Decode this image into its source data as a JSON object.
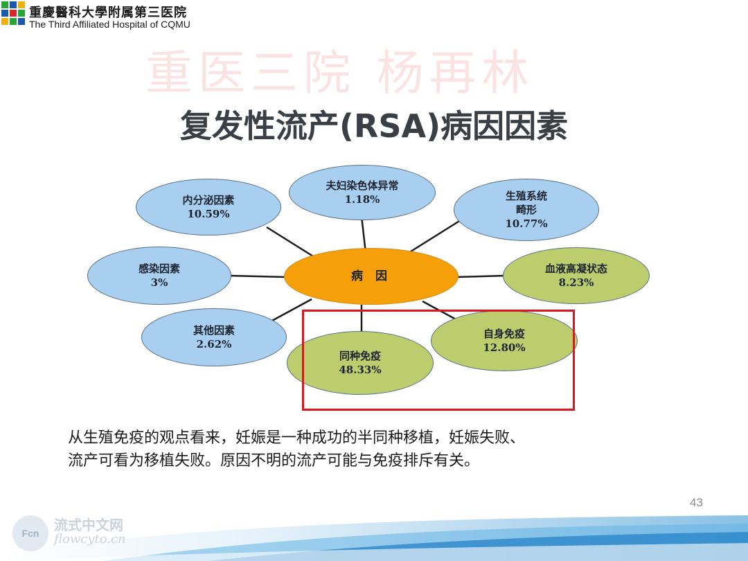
{
  "header": {
    "hospital_cn": "重慶醫科大學附属第三医院",
    "hospital_en": "The Third Affiliated Hospital of CQMU",
    "watermark": "重医三院 杨再林"
  },
  "slide": {
    "title": "复发性流产(RSA)病因因素",
    "page_number": "43"
  },
  "diagram": {
    "center": {
      "label": "病 因"
    },
    "nodes": [
      {
        "id": "chromosome",
        "label": "夫妇染色体异常",
        "value": "1.18%",
        "color": "blue"
      },
      {
        "id": "endocrine",
        "label": "内分泌因素",
        "value": "10.59%",
        "color": "blue"
      },
      {
        "id": "malformation",
        "label": "生殖系统",
        "label2": "畸形",
        "value": "10.77%",
        "color": "blue"
      },
      {
        "id": "infection",
        "label": "感染因素",
        "value": "3%",
        "color": "blue"
      },
      {
        "id": "coagulation",
        "label": "血液高凝状态",
        "value": "8.23%",
        "color": "green"
      },
      {
        "id": "other",
        "label": "其他因素",
        "value": "2.62%",
        "color": "blue"
      },
      {
        "id": "alloimmune",
        "label": "同种免疫",
        "value": "48.33%",
        "color": "green"
      },
      {
        "id": "autoimmune",
        "label": "自身免疫",
        "value": "12.80%",
        "color": "green"
      }
    ],
    "colors": {
      "blue": "#a9cff0",
      "green": "#bdcd6d",
      "center": "#f5a00a",
      "highlight": "#e0141c"
    }
  },
  "text": {
    "line1": "从生殖免疫的观点看来，妊娠是一种成功的半同种移植，妊娠失败、",
    "line2": "流产可看为移植失败。原因不明的流产可能与免疫排斥有关。"
  },
  "footer": {
    "site_cn": "流式中文网",
    "site_en": "flowcyto.cn",
    "badge": "Fcn"
  }
}
